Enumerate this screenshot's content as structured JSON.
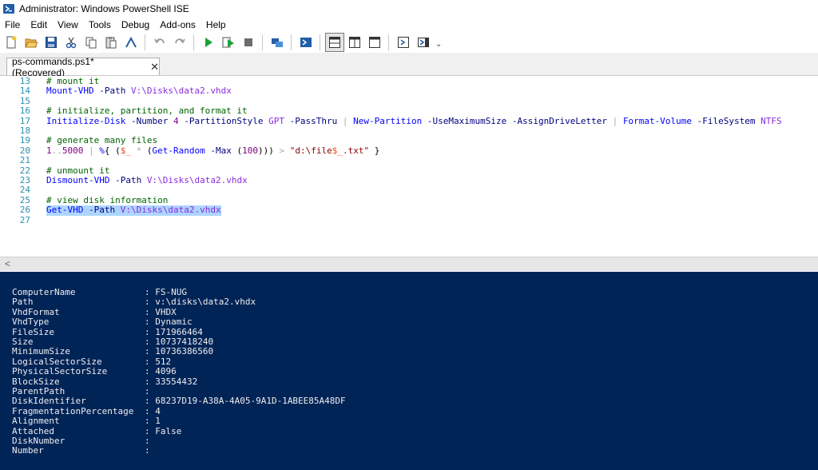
{
  "window": {
    "title": "Administrator: Windows PowerShell ISE"
  },
  "menu": [
    "File",
    "Edit",
    "View",
    "Tools",
    "Debug",
    "Add-ons",
    "Help"
  ],
  "toolbar": {
    "buttons": [
      "new-script-icon",
      "open-icon",
      "save-icon",
      "cut-icon",
      "copy-icon",
      "paste-icon",
      "clear-console-icon",
      "undo-icon",
      "redo-icon",
      "run-script-icon",
      "run-selection-icon",
      "stop-icon",
      "new-remote-tab-icon",
      "start-powershell-icon",
      "show-script-top-icon",
      "show-script-right-icon",
      "show-script-maximized-icon",
      "show-command-window-icon",
      "show-command-addon-icon"
    ],
    "overflow": "⌄"
  },
  "tab": {
    "label": "ps-commands.ps1*(Recovered)",
    "close": "✕"
  },
  "script": {
    "lines": [
      {
        "num": "13",
        "segments": [
          {
            "t": "# mount it",
            "c": "comment"
          }
        ]
      },
      {
        "num": "14",
        "segments": [
          {
            "t": "Mount-VHD",
            "c": "cmd"
          },
          {
            "t": " ",
            "c": "plain"
          },
          {
            "t": "-Path",
            "c": "param"
          },
          {
            "t": " ",
            "c": "plain"
          },
          {
            "t": "V:\\Disks\\data2.vhdx",
            "c": "arg"
          }
        ]
      },
      {
        "num": "15",
        "segments": []
      },
      {
        "num": "16",
        "segments": [
          {
            "t": "# initialize, partition, and format it",
            "c": "comment"
          }
        ]
      },
      {
        "num": "17",
        "segments": [
          {
            "t": "Initialize-Disk",
            "c": "cmd"
          },
          {
            "t": " ",
            "c": "plain"
          },
          {
            "t": "-Number",
            "c": "param"
          },
          {
            "t": " ",
            "c": "plain"
          },
          {
            "t": "4",
            "c": "num"
          },
          {
            "t": " ",
            "c": "plain"
          },
          {
            "t": "-PartitionStyle",
            "c": "param"
          },
          {
            "t": " ",
            "c": "plain"
          },
          {
            "t": "GPT",
            "c": "arg"
          },
          {
            "t": " ",
            "c": "plain"
          },
          {
            "t": "-PassThru",
            "c": "param"
          },
          {
            "t": " | ",
            "c": "op"
          },
          {
            "t": "New-Partition",
            "c": "cmd"
          },
          {
            "t": " ",
            "c": "plain"
          },
          {
            "t": "-UseMaximumSize",
            "c": "param"
          },
          {
            "t": " ",
            "c": "plain"
          },
          {
            "t": "-AssignDriveLetter",
            "c": "param"
          },
          {
            "t": " | ",
            "c": "op"
          },
          {
            "t": "Format-Volume",
            "c": "cmd"
          },
          {
            "t": " ",
            "c": "plain"
          },
          {
            "t": "-FileSystem",
            "c": "param"
          },
          {
            "t": " ",
            "c": "plain"
          },
          {
            "t": "NTFS",
            "c": "arg"
          }
        ]
      },
      {
        "num": "18",
        "segments": []
      },
      {
        "num": "19",
        "segments": [
          {
            "t": "# generate many files",
            "c": "comment"
          }
        ]
      },
      {
        "num": "20",
        "segments": [
          {
            "t": "1",
            "c": "num"
          },
          {
            "t": "..",
            "c": "op"
          },
          {
            "t": "5000",
            "c": "num"
          },
          {
            "t": " | ",
            "c": "op"
          },
          {
            "t": "%",
            "c": "cmd"
          },
          {
            "t": "{ (",
            "c": "plain"
          },
          {
            "t": "$_",
            "c": "var"
          },
          {
            "t": " * ",
            "c": "op"
          },
          {
            "t": "(",
            "c": "plain"
          },
          {
            "t": "Get-Random",
            "c": "cmd"
          },
          {
            "t": " ",
            "c": "plain"
          },
          {
            "t": "-Max",
            "c": "param"
          },
          {
            "t": " (",
            "c": "plain"
          },
          {
            "t": "100",
            "c": "num"
          },
          {
            "t": "))) ",
            "c": "plain"
          },
          {
            "t": ">",
            "c": "op"
          },
          {
            "t": " ",
            "c": "plain"
          },
          {
            "t": "\"d:\\file",
            "c": "str"
          },
          {
            "t": "$_",
            "c": "var"
          },
          {
            "t": ".txt\"",
            "c": "str"
          },
          {
            "t": " }",
            "c": "plain"
          }
        ]
      },
      {
        "num": "21",
        "segments": []
      },
      {
        "num": "22",
        "segments": [
          {
            "t": "# unmount it",
            "c": "comment"
          }
        ]
      },
      {
        "num": "23",
        "segments": [
          {
            "t": "Dismount-VHD",
            "c": "cmd"
          },
          {
            "t": " ",
            "c": "plain"
          },
          {
            "t": "-Path",
            "c": "param"
          },
          {
            "t": " ",
            "c": "plain"
          },
          {
            "t": "V:\\Disks\\data2.vhdx",
            "c": "arg"
          }
        ]
      },
      {
        "num": "24",
        "segments": []
      },
      {
        "num": "25",
        "segments": [
          {
            "t": "# view disk information",
            "c": "comment"
          }
        ]
      },
      {
        "num": "26",
        "selected": true,
        "segments": [
          {
            "t": "Get-VHD",
            "c": "cmd"
          },
          {
            "t": " ",
            "c": "plain"
          },
          {
            "t": "-Path",
            "c": "param"
          },
          {
            "t": " ",
            "c": "plain"
          },
          {
            "t": "V:\\Disks\\data2.vhdx",
            "c": "arg"
          }
        ]
      },
      {
        "num": "27",
        "segments": []
      }
    ]
  },
  "scrollbar": {
    "left_arrow": "<"
  },
  "console": {
    "rows": [
      {
        "key": "ComputerName",
        "sep": ": ",
        "value": "FS-NUG"
      },
      {
        "key": "Path",
        "sep": ": ",
        "value": "v:\\disks\\data2.vhdx"
      },
      {
        "key": "VhdFormat",
        "sep": ": ",
        "value": "VHDX"
      },
      {
        "key": "VhdType",
        "sep": ": ",
        "value": "Dynamic"
      },
      {
        "key": "FileSize",
        "sep": ": ",
        "value": "171966464"
      },
      {
        "key": "Size",
        "sep": ": ",
        "value": "10737418240"
      },
      {
        "key": "MinimumSize",
        "sep": ": ",
        "value": "10736386560"
      },
      {
        "key": "LogicalSectorSize",
        "sep": ": ",
        "value": "512"
      },
      {
        "key": "PhysicalSectorSize",
        "sep": ": ",
        "value": "4096"
      },
      {
        "key": "BlockSize",
        "sep": ": ",
        "value": "33554432"
      },
      {
        "key": "ParentPath",
        "sep": ":",
        "value": ""
      },
      {
        "key": "DiskIdentifier",
        "sep": ": ",
        "value": "68237D19-A38A-4A05-9A1D-1ABEE85A48DF"
      },
      {
        "key": "FragmentationPercentage",
        "sep": ": ",
        "value": "4"
      },
      {
        "key": "Alignment",
        "sep": ": ",
        "value": "1"
      },
      {
        "key": "Attached",
        "sep": ": ",
        "value": "False"
      },
      {
        "key": "DiskNumber",
        "sep": ":",
        "value": ""
      },
      {
        "key": "Number",
        "sep": ":",
        "value": ""
      }
    ]
  }
}
